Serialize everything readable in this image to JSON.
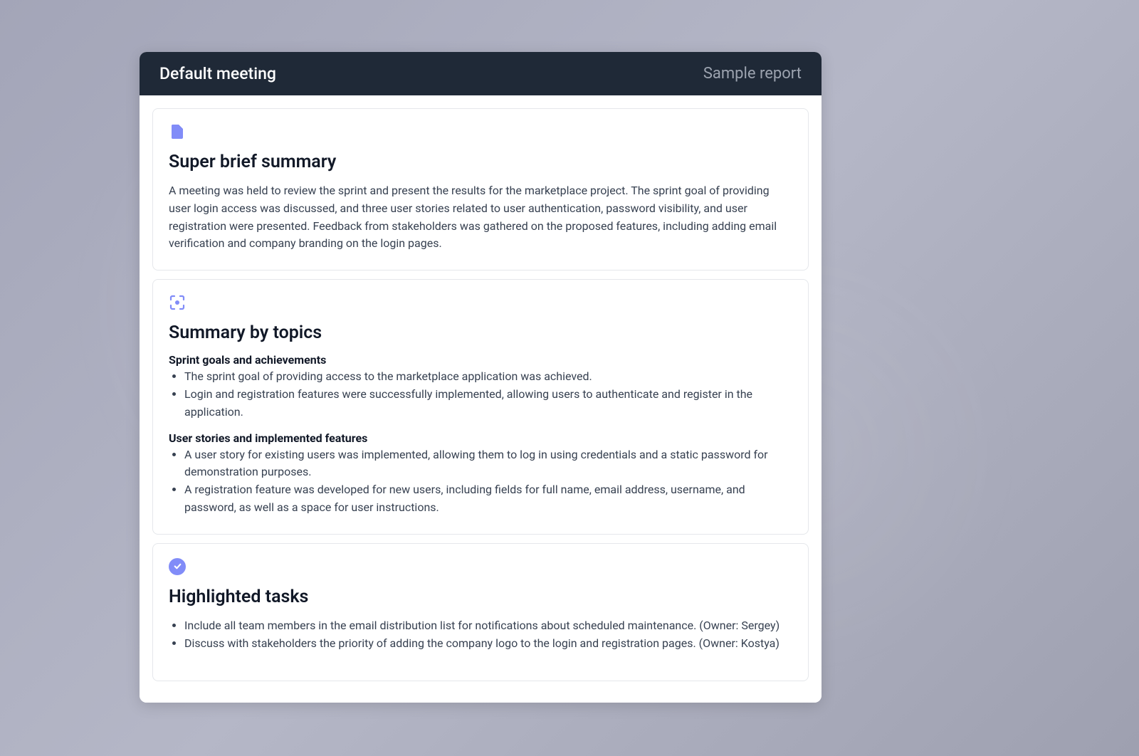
{
  "header": {
    "title": "Default meeting",
    "subtitle": "Sample report"
  },
  "sections": {
    "summary": {
      "title": "Super brief summary",
      "text": "A meeting was held to review the sprint and present the results for the marketplace project. The sprint goal of providing user login access was discussed, and three user stories related to user authentication, password visibility, and user registration were presented. Feedback from stakeholders was gathered on the proposed features, including adding email verification and company branding on the login pages."
    },
    "topics": {
      "title": "Summary by topics",
      "groups": [
        {
          "heading": "Sprint goals and achievements",
          "items": [
            "The sprint goal of providing access to the marketplace application was achieved.",
            "Login and registration features were successfully implemented, allowing users to authenticate and register in the application."
          ]
        },
        {
          "heading": "User stories and implemented features",
          "items": [
            "A user story for existing users was implemented, allowing them to log in using credentials and a static password for demonstration purposes.",
            "A registration feature was developed for new users, including fields for full name, email address, username, and password, as well as a space for user instructions."
          ]
        }
      ]
    },
    "tasks": {
      "title": "Highlighted tasks",
      "items": [
        "Include all team members in the email distribution list for notifications about scheduled maintenance. (Owner: Sergey)",
        "Discuss with stakeholders the priority of adding the company logo to the login and registration pages. (Owner: Kostya)"
      ]
    }
  }
}
